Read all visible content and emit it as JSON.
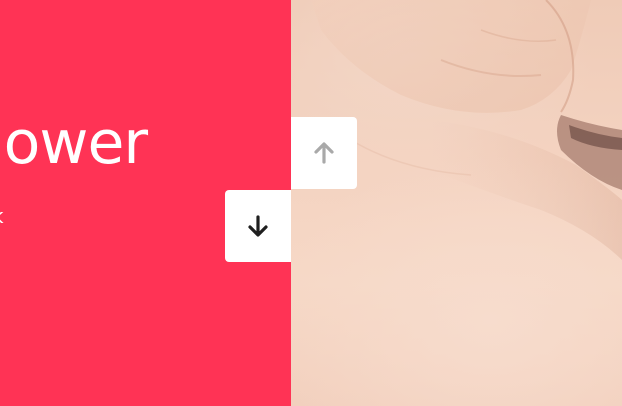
{
  "slide": {
    "headline": "lower",
    "subline": "k"
  },
  "controls": {
    "prev_icon": "arrow-up-icon",
    "next_icon": "arrow-down-icon",
    "prev_enabled": false,
    "next_enabled": true
  },
  "colors": {
    "accent": "#ff3355",
    "text_on_accent": "#ffffff",
    "button_bg": "#ffffff",
    "icon_active": "#1f1f1f",
    "icon_disabled": "#a9a9a9"
  }
}
